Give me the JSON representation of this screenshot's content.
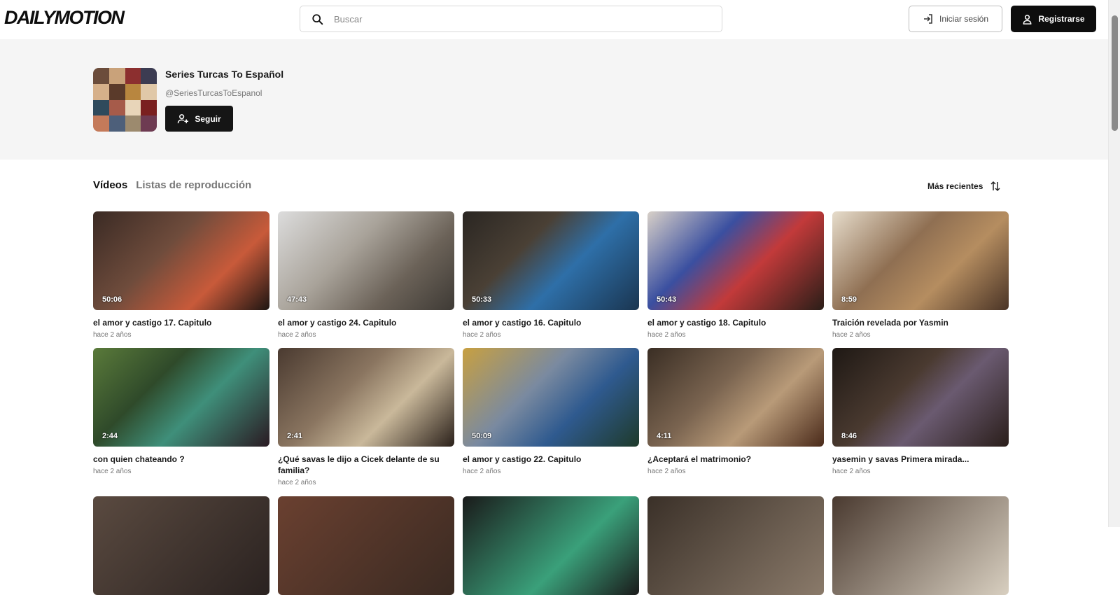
{
  "brand": {
    "logo": "DAILYMOTION"
  },
  "search": {
    "placeholder": "Buscar"
  },
  "header_actions": {
    "login_label": "Iniciar sesión",
    "register_label": "Registrarse"
  },
  "channel": {
    "name": "Series Turcas To Español",
    "handle": "@SeriesTurcasToEspanol",
    "follow_label": "Seguir"
  },
  "tabs": [
    {
      "label": "Vídeos",
      "active": true
    },
    {
      "label": "Listas de reproducción",
      "active": false
    }
  ],
  "sort": {
    "label": "Más recientes"
  },
  "videos_row1": [
    {
      "title": "el amor y castigo 17. Capitulo",
      "date": "hace 2 años",
      "duration": "50:06"
    },
    {
      "title": "el amor y castigo 24. Capitulo",
      "date": "hace 2 años",
      "duration": "47:43"
    },
    {
      "title": "el amor y castigo 16. Capitulo",
      "date": "hace 2 años",
      "duration": "50:33"
    },
    {
      "title": "el amor y castigo 18. Capitulo",
      "date": "hace 2 años",
      "duration": "50:43"
    },
    {
      "title": "Traición revelada por Yasmin",
      "date": "hace 2 años",
      "duration": "8:59"
    }
  ],
  "videos_row2": [
    {
      "title": "con quien chateando ?",
      "date": "hace 2 años",
      "duration": "2:44"
    },
    {
      "title": "¿Qué savas le dijo a Cicek delante de su familia?",
      "date": "hace 2 años",
      "duration": "2:41"
    },
    {
      "title": "el amor y castigo 22. Capitulo",
      "date": "hace 2 años",
      "duration": "50:09"
    },
    {
      "title": "¿Aceptará el matrimonio?",
      "date": "hace 2 años",
      "duration": "4:11"
    },
    {
      "title": "yasemin y savas Primera mirada...",
      "date": "hace 2 años",
      "duration": "8:46"
    }
  ],
  "colors": {
    "accent": "#0d0d0d",
    "header_bg": "#f5f5f5"
  }
}
